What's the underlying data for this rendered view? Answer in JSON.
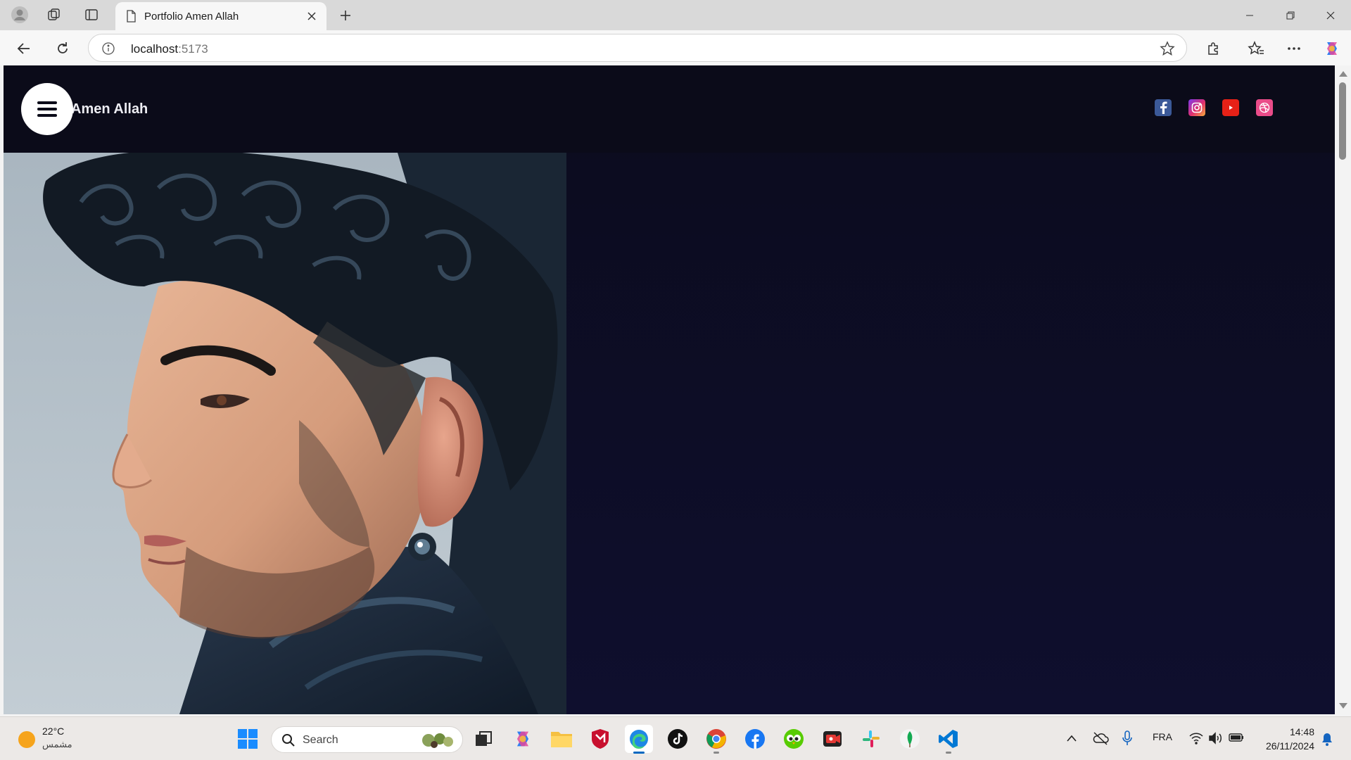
{
  "browser": {
    "tab_title": "Portfolio Amen Allah",
    "url_host": "localhost",
    "url_port": ":5173"
  },
  "site": {
    "brand": "Amen Allah",
    "socials": [
      {
        "name": "facebook",
        "color": "#3b5998"
      },
      {
        "name": "instagram",
        "color": "#c13584"
      },
      {
        "name": "youtube",
        "color": "#e62117"
      },
      {
        "name": "dribbble",
        "color": "#ea4c89"
      }
    ],
    "background": "#0d0d27"
  },
  "taskbar": {
    "weather_temp": "22°C",
    "weather_desc": "مشمس",
    "search_placeholder": "Search",
    "language": "FRA",
    "time": "14:48",
    "date": "26/11/2024"
  }
}
